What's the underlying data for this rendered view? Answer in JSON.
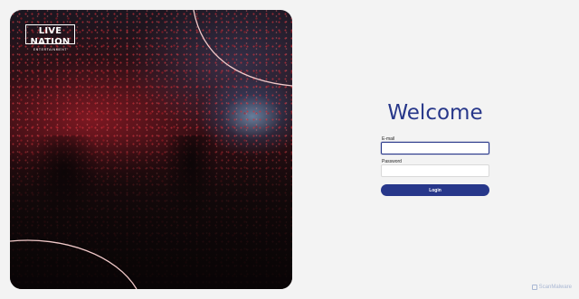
{
  "brand": {
    "logo_line1": "LIVE NATION",
    "logo_line2": "ENTERTAINMENT"
  },
  "login_form": {
    "title": "Welcome",
    "email_label": "E-mail",
    "email_value": "",
    "password_label": "Password",
    "password_value": "",
    "login_label": "Login"
  },
  "watermark": "ScanMalware",
  "colors": {
    "accent": "#27378a",
    "background": "#f3f3f3",
    "watermark": "#a9b7d3"
  }
}
